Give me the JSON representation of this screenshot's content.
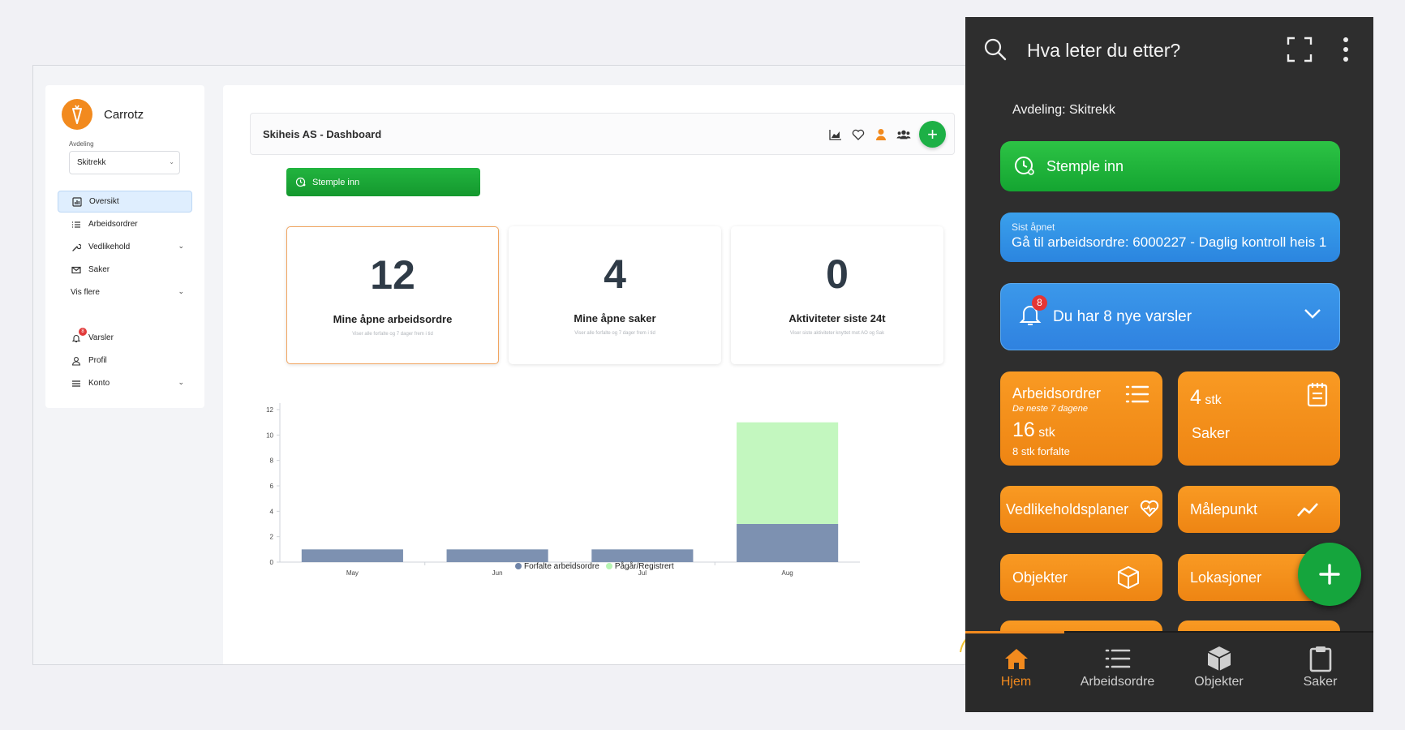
{
  "colors": {
    "brand_orange": "#f28a1e",
    "green": "#1db046",
    "blue": "#2f86e0",
    "overdue": "#7d91b1",
    "in_progress": "#c3f7bf"
  },
  "sidebar": {
    "brand": "Carrotz",
    "dept_label": "Avdeling",
    "dept_value": "Skitrekk",
    "items": [
      {
        "label": "Oversikt",
        "icon": "dashboard-icon"
      },
      {
        "label": "Arbeidsordrer",
        "icon": "list-icon"
      },
      {
        "label": "Vedlikehold",
        "icon": "wrench-icon"
      },
      {
        "label": "Saker",
        "icon": "mail-icon"
      },
      {
        "label": "Vis flere"
      },
      {
        "label": "Varsler",
        "icon": "bell-icon",
        "badge": "8"
      },
      {
        "label": "Profil",
        "icon": "user-icon"
      },
      {
        "label": "Konto",
        "icon": "menu-icon"
      }
    ]
  },
  "header": {
    "title": "Skiheis AS - Dashboard",
    "plus": "+"
  },
  "stamp_label": "Stemple inn",
  "stats": [
    {
      "value": "12",
      "label": "Mine åpne arbeidsordre",
      "sub": "Viser alle forfalte og 7 dager frem i tid"
    },
    {
      "value": "4",
      "label": "Mine åpne saker",
      "sub": "Viser alle forfalte og 7 dager frem i tid"
    },
    {
      "value": "0",
      "label": "Aktiviteter siste 24t",
      "sub": "Viser siste aktiviteter knyttet mot AO og Sak"
    }
  ],
  "chart_data": {
    "type": "bar",
    "stacked": true,
    "categories": [
      "May",
      "Jun",
      "Jul",
      "Aug"
    ],
    "series": [
      {
        "name": "Forfalte arbeidsordre",
        "values": [
          1,
          1,
          1,
          3
        ],
        "color": "#7d91b1"
      },
      {
        "name": "Pågår/Registrert",
        "values": [
          0,
          0,
          0,
          8
        ],
        "color": "#c3f7bf"
      }
    ],
    "yticks": [
      0,
      2,
      4,
      6,
      8,
      10,
      12
    ],
    "ylim": [
      0,
      12
    ],
    "grid": false,
    "legend": "bottom"
  },
  "mobile": {
    "search_placeholder": "Hva leter du etter?",
    "dept": "Avdeling: Skitrekk",
    "stamp": "Stemple inn",
    "last_opened_label": "Sist åpnet",
    "last_opened_value": "Gå til arbeidsordre: 6000227 - Daglig kontroll heis 1",
    "alert_text": "Du har 8 nye varsler",
    "alert_badge": "8",
    "ao_title": "Arbeidsordrer",
    "ao_sub": "De neste 7 dagene",
    "ao_count": "16",
    "ao_unit": " stk",
    "ao_overdue": "8 stk forfalte",
    "saker_count": "4",
    "saker_unit": " stk",
    "saker_label": "Saker",
    "tiles": [
      "Vedlikeholdsplaner",
      "Målepunkt",
      "Objekter",
      "Lokasjoner"
    ],
    "tabs": [
      {
        "label": "Hjem",
        "icon": "home-icon"
      },
      {
        "label": "Arbeidsordre",
        "icon": "list-icon"
      },
      {
        "label": "Objekter",
        "icon": "cube-icon"
      },
      {
        "label": "Saker",
        "icon": "clipboard-icon"
      }
    ]
  }
}
